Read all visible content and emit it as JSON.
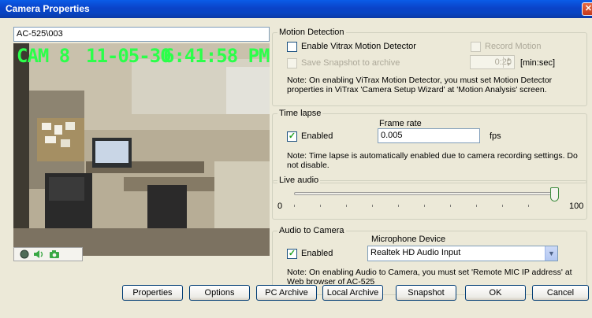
{
  "window": {
    "title": "Camera Properties",
    "close_glyph": "✕"
  },
  "camera": {
    "name": "AC-525\\003",
    "overlay_cam": "CAM 8",
    "overlay_date": "11-05-30",
    "overlay_time": "6:41:58 PM"
  },
  "icons": [
    "record-icon",
    "speaker-icon",
    "snapshot-camera-icon"
  ],
  "motion_detection": {
    "legend": "Motion Detection",
    "enable_label": "Enable Vitrax Motion Detector",
    "enable_checked": false,
    "record_label": "Record Motion",
    "save_snapshot_label": "Save Snapshot to archive",
    "interval_value": "0:20",
    "interval_unit": "[min:sec]",
    "note": "Note: On enabling ViTrax Motion Detector, you must set Motion Detector properties in ViTrax 'Camera Setup Wizard' at 'Motion Analysis' screen."
  },
  "time_lapse": {
    "legend": "Time lapse",
    "enabled_label": "Enabled",
    "enabled_checked": true,
    "frame_rate_label": "Frame rate",
    "frame_rate_value": "0.005",
    "frame_rate_unit": "fps",
    "note": "Note: Time lapse is automatically enabled due to camera recording settings. Do not disable."
  },
  "live_audio": {
    "legend": "Live audio",
    "min_label": "0",
    "max_label": "100",
    "level": 100
  },
  "audio_to_camera": {
    "legend": "Audio to Camera",
    "enabled_label": "Enabled",
    "enabled_checked": true,
    "device_label": "Microphone Device",
    "device_value": "Realtek HD Audio Input",
    "note": "Note: On enabling Audio to Camera, you must set 'Remote MIC IP address' at Web browser of AC-525"
  },
  "buttons": {
    "properties": "Properties",
    "options": "Options",
    "pc_archive": "PC Archive",
    "local_archive": "Local Archive",
    "snapshot": "Snapshot",
    "ok": "OK",
    "cancel": "Cancel"
  },
  "colors": {
    "title_bar": "#0a43c8",
    "dialog_bg": "#ece9d8",
    "overlay_text": "#2bff4a",
    "check_green": "#21a121"
  }
}
